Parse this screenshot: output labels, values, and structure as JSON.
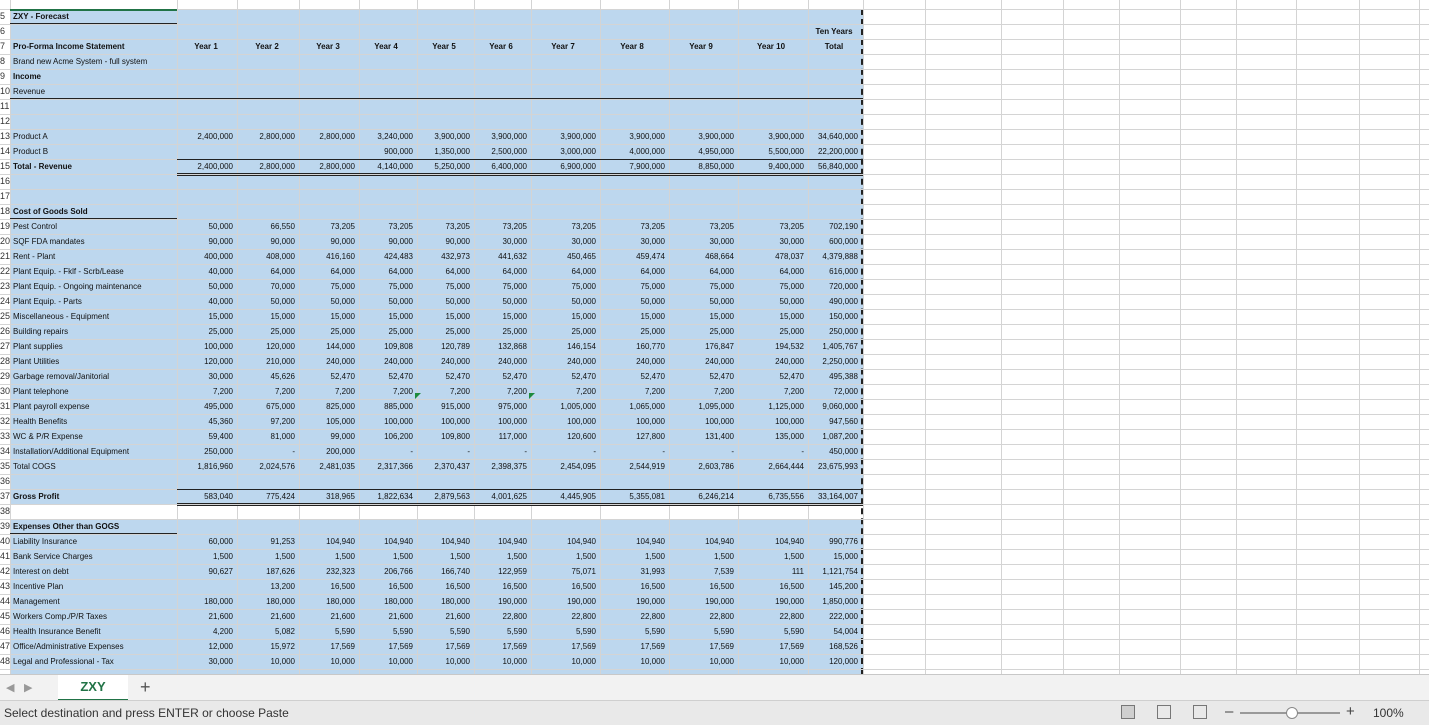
{
  "sheet": {
    "rows": [
      {
        "label": "ZXY - Forecast",
        "bold": true,
        "values": []
      },
      {
        "label": "",
        "values": []
      },
      {
        "label": "Pro-Forma Income Statement",
        "bold": true,
        "values": []
      },
      {
        "label": "Brand new Acme System - full system",
        "values": []
      },
      {
        "label": "Income",
        "bold": true,
        "values": []
      },
      {
        "label": "Revenue",
        "values": []
      },
      {
        "label": "",
        "values": []
      },
      {
        "label": "",
        "values": []
      },
      {
        "label": "Product A",
        "values": [
          "2,400,000",
          "2,800,000",
          "2,800,000",
          "3,240,000",
          "3,900,000",
          "3,900,000",
          "3,900,000",
          "3,900,000",
          "3,900,000",
          "3,900,000",
          "34,640,000"
        ]
      },
      {
        "label": "Product B",
        "values": [
          "",
          "",
          "",
          "900,000",
          "1,350,000",
          "2,500,000",
          "3,000,000",
          "4,000,000",
          "4,950,000",
          "5,500,000",
          "22,200,000"
        ]
      },
      {
        "label": "Total - Revenue",
        "bold": true,
        "values": [
          "2,400,000",
          "2,800,000",
          "2,800,000",
          "4,140,000",
          "5,250,000",
          "6,400,000",
          "6,900,000",
          "7,900,000",
          "8,850,000",
          "9,400,000",
          "56,840,000"
        ]
      },
      {
        "label": "",
        "values": []
      },
      {
        "label": "",
        "values": []
      },
      {
        "label": "Cost of Goods Sold",
        "bold": true,
        "values": []
      },
      {
        "label": "Pest Control",
        "values": [
          "50,000",
          "66,550",
          "73,205",
          "73,205",
          "73,205",
          "73,205",
          "73,205",
          "73,205",
          "73,205",
          "73,205",
          "702,190"
        ]
      },
      {
        "label": "SQF FDA mandates",
        "values": [
          "90,000",
          "90,000",
          "90,000",
          "90,000",
          "90,000",
          "30,000",
          "30,000",
          "30,000",
          "30,000",
          "30,000",
          "600,000"
        ]
      },
      {
        "label": "Rent - Plant",
        "values": [
          "400,000",
          "408,000",
          "416,160",
          "424,483",
          "432,973",
          "441,632",
          "450,465",
          "459,474",
          "468,664",
          "478,037",
          "4,379,888"
        ]
      },
      {
        "label": "Plant Equip. - Fklf - Scrb/Lease",
        "values": [
          "40,000",
          "64,000",
          "64,000",
          "64,000",
          "64,000",
          "64,000",
          "64,000",
          "64,000",
          "64,000",
          "64,000",
          "616,000"
        ]
      },
      {
        "label": "Plant Equip. - Ongoing maintenance",
        "values": [
          "50,000",
          "70,000",
          "75,000",
          "75,000",
          "75,000",
          "75,000",
          "75,000",
          "75,000",
          "75,000",
          "75,000",
          "720,000"
        ]
      },
      {
        "label": "Plant Equip. - Parts",
        "values": [
          "40,000",
          "50,000",
          "50,000",
          "50,000",
          "50,000",
          "50,000",
          "50,000",
          "50,000",
          "50,000",
          "50,000",
          "490,000"
        ]
      },
      {
        "label": "Miscellaneous - Equipment",
        "values": [
          "15,000",
          "15,000",
          "15,000",
          "15,000",
          "15,000",
          "15,000",
          "15,000",
          "15,000",
          "15,000",
          "15,000",
          "150,000"
        ]
      },
      {
        "label": "Building repairs",
        "values": [
          "25,000",
          "25,000",
          "25,000",
          "25,000",
          "25,000",
          "25,000",
          "25,000",
          "25,000",
          "25,000",
          "25,000",
          "250,000"
        ]
      },
      {
        "label": "Plant supplies",
        "values": [
          "100,000",
          "120,000",
          "144,000",
          "109,808",
          "120,789",
          "132,868",
          "146,154",
          "160,770",
          "176,847",
          "194,532",
          "1,405,767"
        ]
      },
      {
        "label": "Plant Utilities",
        "values": [
          "120,000",
          "210,000",
          "240,000",
          "240,000",
          "240,000",
          "240,000",
          "240,000",
          "240,000",
          "240,000",
          "240,000",
          "2,250,000"
        ]
      },
      {
        "label": "Garbage removal/Janitorial",
        "values": [
          "30,000",
          "45,626",
          "52,470",
          "52,470",
          "52,470",
          "52,470",
          "52,470",
          "52,470",
          "52,470",
          "52,470",
          "495,388"
        ]
      },
      {
        "label": "Plant telephone",
        "values": [
          "7,200",
          "7,200",
          "7,200",
          "7,200",
          "7,200",
          "7,200",
          "7,200",
          "7,200",
          "7,200",
          "7,200",
          "72,000"
        ]
      },
      {
        "label": "Plant payroll expense",
        "values": [
          "495,000",
          "675,000",
          "825,000",
          "885,000",
          "915,000",
          "975,000",
          "1,005,000",
          "1,065,000",
          "1,095,000",
          "1,125,000",
          "9,060,000"
        ]
      },
      {
        "label": "Health Benefits",
        "values": [
          "45,360",
          "97,200",
          "105,000",
          "100,000",
          "100,000",
          "100,000",
          "100,000",
          "100,000",
          "100,000",
          "100,000",
          "947,560"
        ]
      },
      {
        "label": "WC & P/R Expense",
        "values": [
          "59,400",
          "81,000",
          "99,000",
          "106,200",
          "109,800",
          "117,000",
          "120,600",
          "127,800",
          "131,400",
          "135,000",
          "1,087,200"
        ]
      },
      {
        "label": "Installation/Additional Equipment",
        "values": [
          "250,000",
          "-",
          "200,000",
          "-",
          "-",
          "-",
          "-",
          "-",
          "-",
          "-",
          "450,000"
        ]
      },
      {
        "label": "Total COGS",
        "values": [
          "1,816,960",
          "2,024,576",
          "2,481,035",
          "2,317,366",
          "2,370,437",
          "2,398,375",
          "2,454,095",
          "2,544,919",
          "2,603,786",
          "2,664,444",
          "23,675,993"
        ]
      },
      {
        "label": "",
        "values": []
      },
      {
        "label": "Gross Profit",
        "bold": true,
        "values": [
          "583,040",
          "775,424",
          "318,965",
          "1,822,634",
          "2,879,563",
          "4,001,625",
          "4,445,905",
          "5,355,081",
          "6,246,214",
          "6,735,556",
          "33,164,007"
        ]
      },
      {
        "label": "",
        "values": []
      },
      {
        "label": "Expenses Other than GOGS",
        "bold": true,
        "values": []
      },
      {
        "label": "Liability Insurance",
        "values": [
          "60,000",
          "91,253",
          "104,940",
          "104,940",
          "104,940",
          "104,940",
          "104,940",
          "104,940",
          "104,940",
          "104,940",
          "990,776"
        ]
      },
      {
        "label": "Bank Service Charges",
        "values": [
          "1,500",
          "1,500",
          "1,500",
          "1,500",
          "1,500",
          "1,500",
          "1,500",
          "1,500",
          "1,500",
          "1,500",
          "15,000"
        ]
      },
      {
        "label": "Interest on debt",
        "values": [
          "90,627",
          "187,626",
          "232,323",
          "206,766",
          "166,740",
          "122,959",
          "75,071",
          "31,993",
          "7,539",
          "111",
          "1,121,754"
        ]
      },
      {
        "label": "Incentive Plan",
        "values": [
          "",
          "13,200",
          "16,500",
          "16,500",
          "16,500",
          "16,500",
          "16,500",
          "16,500",
          "16,500",
          "16,500",
          "145,200"
        ]
      },
      {
        "label": "Management",
        "values": [
          "180,000",
          "180,000",
          "180,000",
          "180,000",
          "180,000",
          "190,000",
          "190,000",
          "190,000",
          "190,000",
          "190,000",
          "1,850,000"
        ]
      },
      {
        "label": "Workers Comp./P/R Taxes",
        "values": [
          "21,600",
          "21,600",
          "21,600",
          "21,600",
          "21,600",
          "22,800",
          "22,800",
          "22,800",
          "22,800",
          "22,800",
          "222,000"
        ]
      },
      {
        "label": "Health Insurance Benefit",
        "values": [
          "4,200",
          "5,082",
          "5,590",
          "5,590",
          "5,590",
          "5,590",
          "5,590",
          "5,590",
          "5,590",
          "5,590",
          "54,004"
        ]
      },
      {
        "label": "Office/Administrative Expenses",
        "values": [
          "12,000",
          "15,972",
          "17,569",
          "17,569",
          "17,569",
          "17,569",
          "17,569",
          "17,569",
          "17,569",
          "17,569",
          "168,526"
        ]
      },
      {
        "label": "Legal and Professional - Tax",
        "values": [
          "30,000",
          "10,000",
          "10,000",
          "10,000",
          "10,000",
          "10,000",
          "10,000",
          "10,000",
          "10,000",
          "10,000",
          "120,000"
        ]
      }
    ],
    "row_numbers": [
      "5",
      "6",
      "7",
      "8",
      "9",
      "10",
      "11",
      "12",
      "13",
      "14",
      "15",
      "16",
      "17",
      "18",
      "19",
      "20",
      "21",
      "22",
      "23",
      "24",
      "25",
      "26",
      "27",
      "28",
      "29",
      "30",
      "31",
      "32",
      "33",
      "34",
      "35",
      "36",
      "37",
      "38",
      "39",
      "40",
      "41",
      "42",
      "43",
      "44",
      "45",
      "46",
      "47",
      "48"
    ],
    "year_headers": [
      "Year 1",
      "Year 2",
      "Year 3",
      "Year 4",
      "Year 5",
      "Year 6",
      "Year 7",
      "Year 8",
      "Year 9",
      "Year 10"
    ],
    "total_header_line1": "Ten Years",
    "total_header_line2": "Total"
  },
  "tabs": {
    "active_sheet": "ZXY",
    "add_sheet_symbol": "+",
    "prev_symbol": "◀",
    "next_symbol": "▶"
  },
  "status": {
    "message": "Select destination and press ENTER or choose Paste",
    "zoom": "100%",
    "zoom_minus": "–",
    "zoom_plus": "+"
  }
}
